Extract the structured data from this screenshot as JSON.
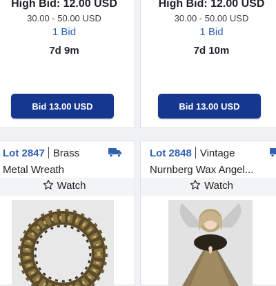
{
  "colors": {
    "accent": "#16378f",
    "link": "#2f5fb0"
  },
  "top_lots": [
    {
      "high_bid": "High Bid: 12.00 USD",
      "estimate": "30.00 - 50.00 USD",
      "bids": "1 Bid",
      "time_left": "7d 9m",
      "bid_button": "Bid 13.00 USD"
    },
    {
      "high_bid": "High Bid: 12.00 USD",
      "estimate": "30.00 - 50.00 USD",
      "bids": "1 Bid",
      "time_left": "7d 10m",
      "bid_button": "Bid 13.00 USD"
    }
  ],
  "bottom_lots": [
    {
      "lot": "Lot 2847",
      "title_a": "Brass",
      "title_b": "Metal Wreath",
      "watch": "Watch",
      "shipping_icon": "truck-icon",
      "image": "brass-metal-wreath-photo"
    },
    {
      "lot": "Lot 2848",
      "title_a": "Vintage",
      "title_b": "Nurnberg Wax Angel...",
      "watch": "Watch",
      "shipping_icon": "truck-icon",
      "image": "wax-angel-photo"
    }
  ]
}
